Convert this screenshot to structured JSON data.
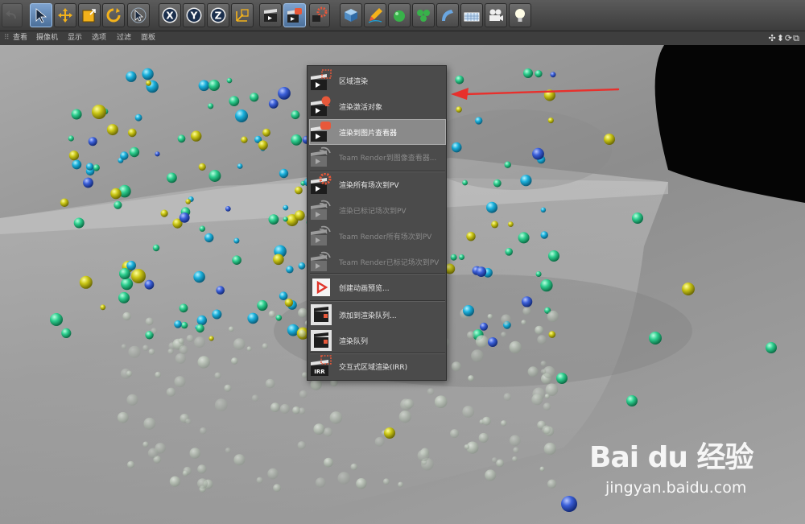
{
  "menubar": {
    "items": [
      "查看",
      "摄像机",
      "显示",
      "选项",
      "过滤",
      "面板"
    ],
    "nav_arrows": "✣⬍⟳⧉"
  },
  "toolbar": {
    "buttons": [
      {
        "name": "undo-button",
        "icon": "undo-icon"
      },
      {
        "name": "select-tool-button",
        "icon": "cursor-icon"
      },
      {
        "name": "move-tool-button",
        "icon": "move-icon"
      },
      {
        "name": "scale-tool-button",
        "icon": "scale-icon"
      },
      {
        "name": "rotate-tool-button",
        "icon": "rotate-icon"
      },
      {
        "name": "live-select-button",
        "icon": "cursor-icon"
      },
      {
        "name": "x-axis-button",
        "icon": "x-axis-icon",
        "label": "X"
      },
      {
        "name": "y-axis-button",
        "icon": "y-axis-icon",
        "label": "Y"
      },
      {
        "name": "z-axis-button",
        "icon": "z-axis-icon",
        "label": "Z"
      },
      {
        "name": "coordinate-system-button",
        "icon": "coordinate-icon"
      },
      {
        "name": "render-view-button",
        "icon": "clapboard-icon"
      },
      {
        "name": "render-to-picture-viewer-button",
        "icon": "clapboard-icon"
      },
      {
        "name": "render-settings-button",
        "icon": "gear-icon"
      },
      {
        "name": "cube-button",
        "icon": "cube-icon"
      },
      {
        "name": "pen-button",
        "icon": "pen-icon"
      },
      {
        "name": "subdivision-button",
        "icon": "green-object-icon"
      },
      {
        "name": "cloner-button",
        "icon": "green-object-icon"
      },
      {
        "name": "deformer-button",
        "icon": "bend-icon"
      },
      {
        "name": "floor-button",
        "icon": "grid-icon"
      },
      {
        "name": "camera-button",
        "icon": "camera-icon"
      },
      {
        "name": "light-button",
        "icon": "light-icon"
      }
    ]
  },
  "render_menu": {
    "items": [
      {
        "label": "区域渲染",
        "icon": "region-render-icon",
        "enabled": true
      },
      {
        "label": "渲染激活对象",
        "icon": "render-active-icon",
        "enabled": true
      },
      {
        "label": "渲染到图片查看器",
        "icon": "render-picture-viewer-icon",
        "enabled": true,
        "highlighted": true
      },
      {
        "label": "Team Render到图像查看器...",
        "icon": "team-render-icon",
        "enabled": false
      },
      {
        "label": "渲染所有场次到PV",
        "icon": "render-takes-icon",
        "enabled": true
      },
      {
        "label": "渲染已标记场次到PV",
        "icon": "team-render-icon",
        "enabled": false
      },
      {
        "label": "Team Render所有场次到PV",
        "icon": "team-render-icon",
        "enabled": false
      },
      {
        "label": "Team Render已标记场次到PV",
        "icon": "team-render-icon",
        "enabled": false
      },
      {
        "label": "创建动画预览...",
        "icon": "play-icon",
        "enabled": true
      },
      {
        "label": "添加到渲染队列...",
        "icon": "render-queue-add-icon",
        "enabled": true
      },
      {
        "label": "渲染队列",
        "icon": "render-queue-icon",
        "enabled": true
      },
      {
        "label": "交互式区域渲染(IRR)",
        "icon": "irr-icon",
        "enabled": true,
        "icon_text": "IRR"
      }
    ]
  },
  "annotation": {
    "color": "#e8302c"
  },
  "watermark": {
    "logo": "Bai du 经验",
    "url": "jingyan.baidu.com"
  },
  "colors": {
    "accent": "#7ea3cf",
    "highlight": "#8a8a8a",
    "arrow": "#e8302c"
  }
}
